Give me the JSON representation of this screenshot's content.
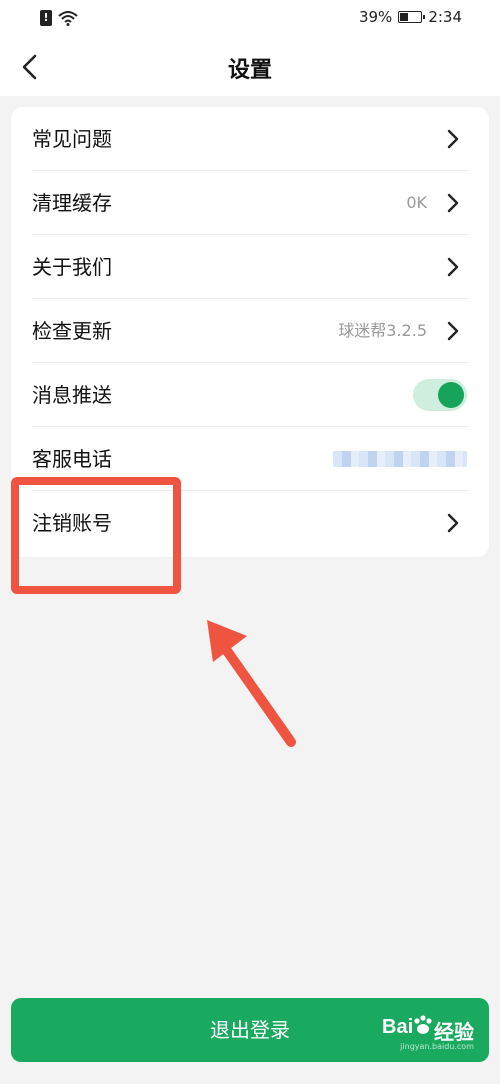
{
  "status_bar": {
    "battery": "39%",
    "time": "2:34"
  },
  "header": {
    "title": "设置"
  },
  "settings": {
    "items": [
      {
        "label": "常见问题",
        "value": ""
      },
      {
        "label": "清理缓存",
        "value": "0K"
      },
      {
        "label": "关于我们",
        "value": ""
      },
      {
        "label": "检查更新",
        "value": "球迷帮3.2.5"
      },
      {
        "label": "消息推送",
        "value": "",
        "toggle_on": true
      },
      {
        "label": "客服电话",
        "value": ""
      },
      {
        "label": "注销账号",
        "value": ""
      }
    ]
  },
  "footer": {
    "logout_label": "退出登录"
  },
  "watermark": {
    "text": "Bai",
    "text2": "经验",
    "sub": "jingyan.baidu.com"
  },
  "colors": {
    "accent": "#1aaa5f",
    "annotation": "#ef5441"
  }
}
